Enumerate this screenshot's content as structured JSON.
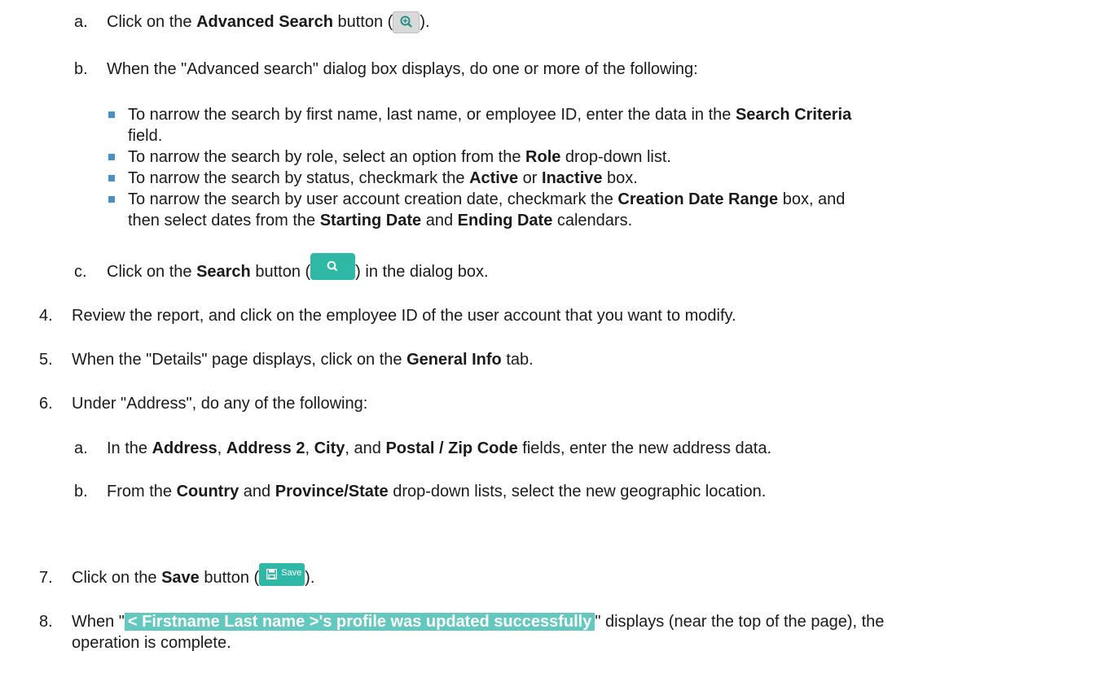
{
  "steps": {
    "a1": {
      "marker": "a.",
      "pre": "Click on the ",
      "bold": "Advanced Search",
      "mid": " button (",
      "post": ")."
    },
    "b1": {
      "marker": "b.",
      "text": "When the \"Advanced search\" dialog box displays, do one or more of the following:"
    },
    "bullets": {
      "one": {
        "pre": "To narrow the search by first name, last name, or employee ID, enter the data in the ",
        "bold": "Search Criteria",
        "post": "field."
      },
      "two": {
        "pre": "To narrow the search by role, select an option from the ",
        "bold": "Role",
        "post": " drop-down list."
      },
      "three": {
        "pre": "To narrow the search by status, checkmark the ",
        "bold1": "Active",
        "mid": " or ",
        "bold2": "Inactive",
        "post": " box."
      },
      "four": {
        "pre": "To narrow the search by user account creation date, checkmark the ",
        "bold1": "Creation Date Range",
        "mid": " box, and",
        "line2pre": "then select dates from the ",
        "bold2": "Starting Date",
        "and": " and ",
        "bold3": "Ending Date",
        "post": " calendars."
      }
    },
    "c1": {
      "marker": "c.",
      "pre": "Click on the ",
      "bold": "Search",
      "mid": " button (",
      "post": ") in the dialog box."
    },
    "s4": {
      "marker": "4.",
      "text": "Review the report, and click on the employee ID of the user account that you want to modify."
    },
    "s5": {
      "marker": "5.",
      "pre": "When the \"Details\" page displays, click on the ",
      "bold": "General Info",
      "post": " tab."
    },
    "s6": {
      "marker": "6.",
      "text": "Under \"Address\", do any of the following:"
    },
    "a2": {
      "marker": "a.",
      "pre": "In the ",
      "b1": "Address",
      "c1": ", ",
      "b2": "Address 2",
      "c2": ", ",
      "b3": "City",
      "c3": ", and ",
      "b4": "Postal / Zip Code",
      "post": " fields, enter the new address data."
    },
    "b2": {
      "marker": "b.",
      "pre": "From the ",
      "b1": "Country",
      "mid": " and ",
      "b2": "Province/State",
      "post": " drop-down lists, select the new geographic location."
    },
    "s7": {
      "marker": "7.",
      "pre": "Click on the ",
      "bold": "Save",
      "mid": " button (",
      "post": ").",
      "save_label": "Save"
    },
    "s8": {
      "marker": "8.",
      "pre": "When \"",
      "highlight": "< Firstname Last name >'s profile was updated successfully",
      "post": "\" displays (near the top of the page), the",
      "line2": "operation is complete."
    }
  },
  "colors": {
    "accent": "#2fb8a5",
    "highlight": "#63c8bf",
    "bullet": "#4a90c8"
  },
  "icons": {
    "advanced_search": "zoom-plus-icon",
    "search": "search-icon",
    "save": "floppy-disk-icon"
  }
}
